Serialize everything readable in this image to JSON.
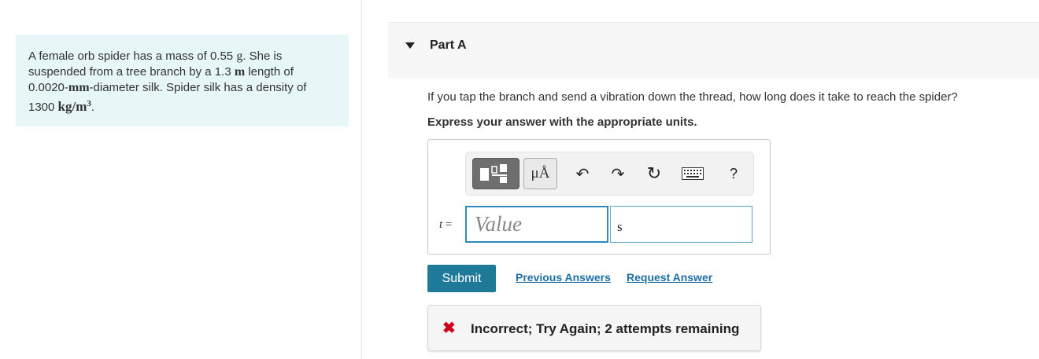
{
  "problem": {
    "text_1": "A female orb spider has a mass of 0.55 ",
    "unit_g": "g",
    "text_2": ". She is",
    "line_2_a": "suspended from a tree branch by a 1.3 ",
    "unit_m": "m",
    "line_2_b": " length of",
    "line_3_a": "0.0020-",
    "unit_mm": "mm",
    "line_3_b": "-diameter silk. Spider silk has a density of",
    "line_4_a": "1300 ",
    "unit_density": "kg/m",
    "density_exp": "3",
    "line_4_b": "."
  },
  "part": {
    "title": "Part A",
    "question": "If you tap the branch and send a vibration down the thread, how long does it take to reach the spider?",
    "instruction": "Express your answer with the appropriate units."
  },
  "toolbar": {
    "units_label": "μÅ",
    "undo_glyph": "↶",
    "redo_glyph": "↷",
    "reset_glyph": "↻",
    "help_label": "?"
  },
  "answer": {
    "variable": "t",
    "equals": " =",
    "value_placeholder": "Value",
    "units_value": "s"
  },
  "actions": {
    "submit_label": "Submit",
    "previous_answers": "Previous Answers",
    "request_answer": "Request Answer"
  },
  "feedback": {
    "icon": "✖",
    "message": "Incorrect; Try Again; 2 attempts remaining"
  },
  "colors": {
    "problem_bg": "#e7f6f7",
    "submit_bg": "#1f7a99",
    "link": "#1f6fa3",
    "error": "#d0021b"
  }
}
